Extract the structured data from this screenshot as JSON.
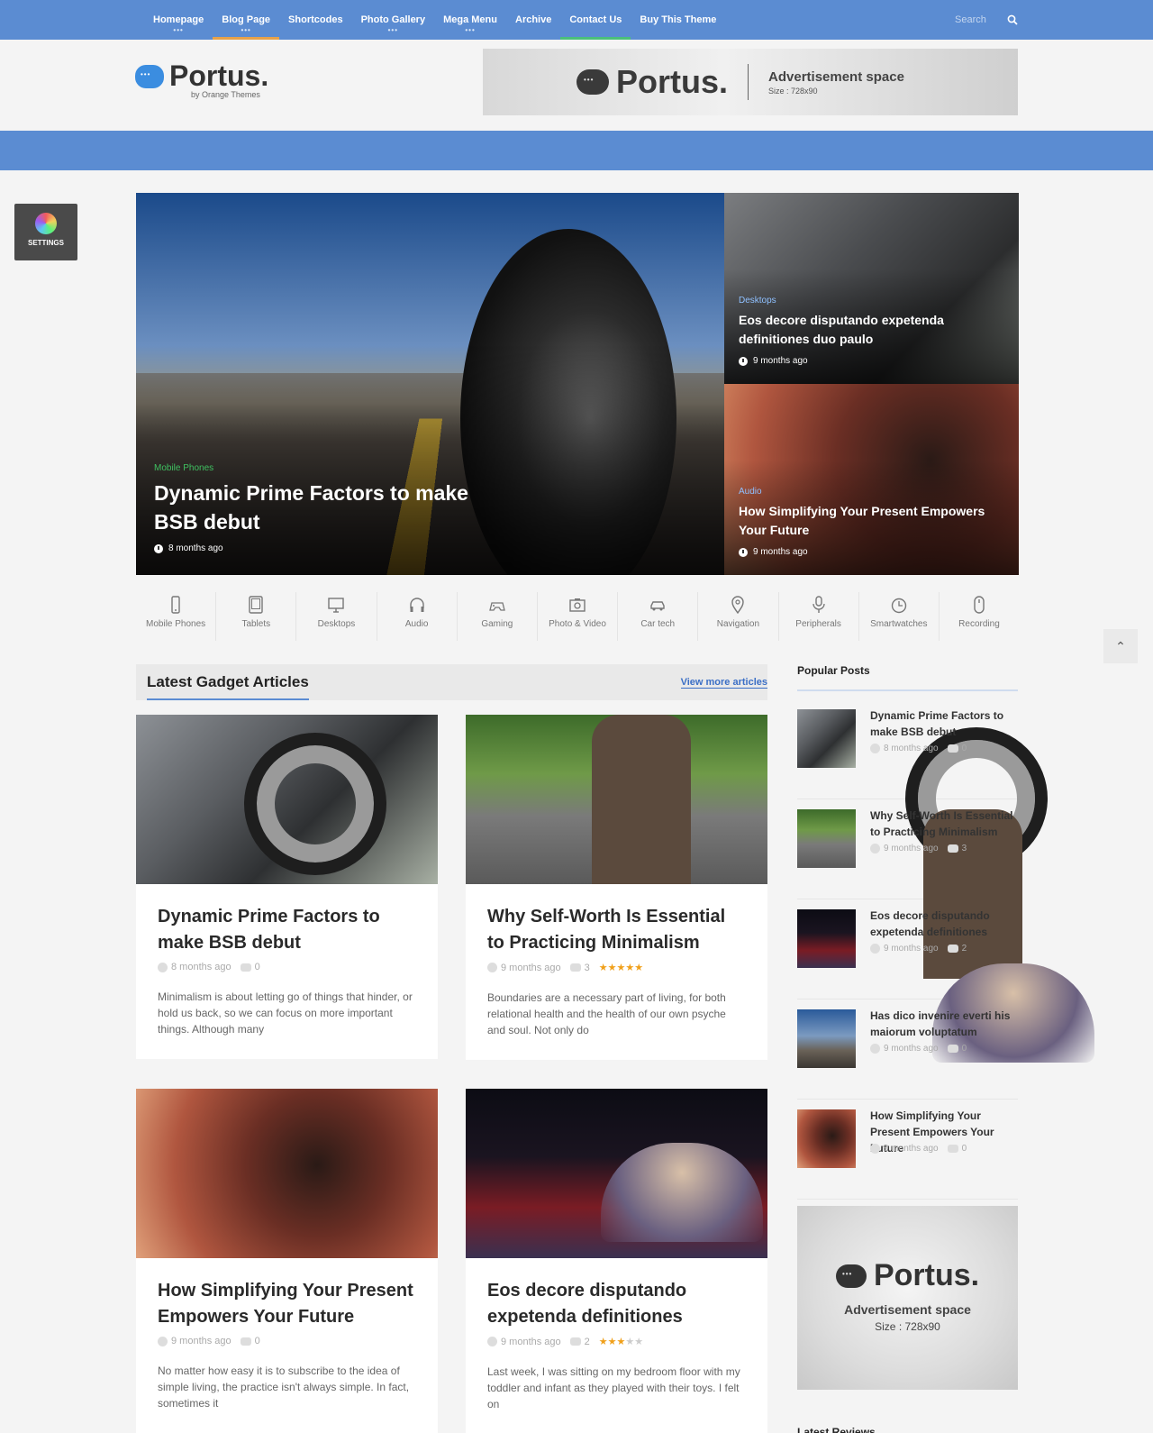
{
  "nav": {
    "items": [
      "Homepage",
      "Blog Page",
      "Shortcodes",
      "Photo Gallery",
      "Mega Menu",
      "Archive",
      "Contact Us",
      "Buy This Theme"
    ],
    "search_placeholder": "Search"
  },
  "brand": {
    "name": "Portus.",
    "byline": "by Orange Themes"
  },
  "ad_top": {
    "brand": "Portus.",
    "title": "Advertisement space",
    "size": "Size : 728x90"
  },
  "settings_label": "SETTINGS",
  "hero": {
    "main": {
      "category": "Mobile Phones",
      "title": "Dynamic Prime Factors to make BSB debut",
      "time": "8 months ago"
    },
    "side": [
      {
        "category": "Desktops",
        "title": "Eos decore disputando expetenda definitiones duo paulo",
        "time": "9 months ago"
      },
      {
        "category": "Audio",
        "title": "How Simplifying Your Present Empowers Your Future",
        "time": "9 months ago"
      }
    ]
  },
  "categories": [
    {
      "label": "Mobile Phones",
      "icon": "mobile-phone-icon"
    },
    {
      "label": "Tablets",
      "icon": "tablet-icon"
    },
    {
      "label": "Desktops",
      "icon": "desktop-icon"
    },
    {
      "label": "Audio",
      "icon": "headphones-icon"
    },
    {
      "label": "Gaming",
      "icon": "gamepad-icon"
    },
    {
      "label": "Photo & Video",
      "icon": "camera-icon"
    },
    {
      "label": "Car tech",
      "icon": "car-icon"
    },
    {
      "label": "Navigation",
      "icon": "map-pin-icon"
    },
    {
      "label": "Peripherals",
      "icon": "microphone-icon"
    },
    {
      "label": "Smartwatches",
      "icon": "clock-icon"
    },
    {
      "label": "Recording",
      "icon": "mouse-icon"
    }
  ],
  "latest": {
    "title": "Latest Gadget Articles",
    "view_more": "View more articles",
    "articles": [
      {
        "title": "Dynamic Prime Factors to make BSB debut",
        "time": "8 months ago",
        "comments": "0",
        "rating": 0,
        "excerpt": "Minimalism is about letting go of things that hinder, or hold us back, so we can focus on more important things. Although many"
      },
      {
        "title": "Why Self-Worth Is Essential to Practicing Minimalism",
        "time": "9 months ago",
        "comments": "3",
        "rating": 5,
        "excerpt": "Boundaries are a necessary part of living, for both relational health and the health of our own psyche and soul. Not only do"
      },
      {
        "title": "How Simplifying Your Present Empowers Your Future",
        "time": "9 months ago",
        "comments": "0",
        "rating": 0,
        "excerpt": "No matter how easy it is to subscribe to the idea of simple living, the practice isn't always simple. In fact, sometimes it"
      },
      {
        "title": "Eos decore disputando expetenda definitiones",
        "time": "9 months ago",
        "comments": "2",
        "rating": 3,
        "excerpt": "Last week, I was sitting on my bedroom floor with my toddler and infant as they played with their toys. I felt on"
      }
    ]
  },
  "popular": {
    "title": "Popular Posts",
    "items": [
      {
        "title": "Dynamic Prime Factors to make BSB debut",
        "time": "8 months ago",
        "comments": "0"
      },
      {
        "title": "Why Self-Worth Is Essential to Practicing Minimalism",
        "time": "9 months ago",
        "comments": "3"
      },
      {
        "title": "Eos decore disputando expetenda definitiones",
        "time": "9 months ago",
        "comments": "2"
      },
      {
        "title": "Has dico invenire everti his maiorum voluptatum",
        "time": "9 months ago",
        "comments": "0"
      },
      {
        "title": "How Simplifying Your Present Empowers Your Future",
        "time": "9 months ago",
        "comments": "0"
      }
    ]
  },
  "ad_side": {
    "brand": "Portus.",
    "title": "Advertisement space",
    "size": "Size : 728x90"
  },
  "latest_reviews_title": "Latest Reviews",
  "colors": {
    "nav_bg": "#5b8cd2",
    "accent_link": "#3b6fc6",
    "star": "#f0a01a",
    "hero_category_green": "#3fc060"
  }
}
